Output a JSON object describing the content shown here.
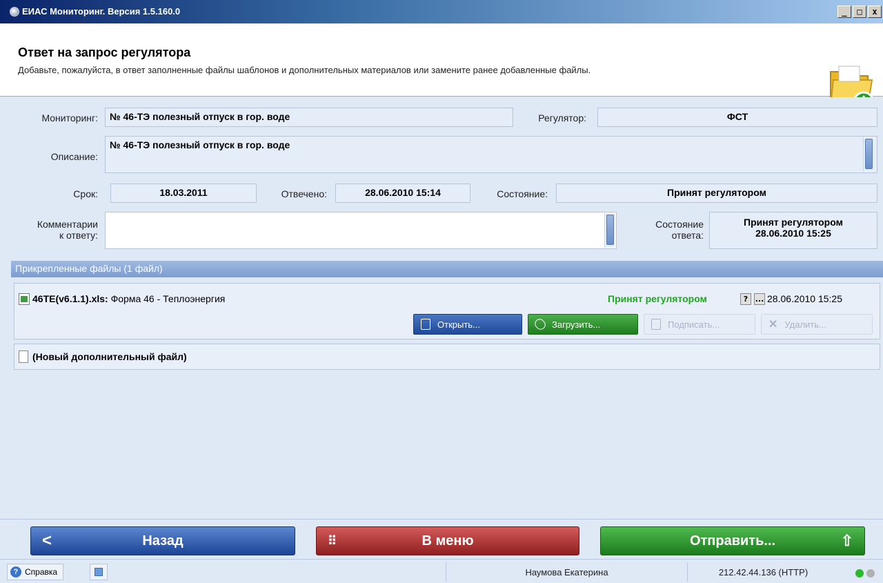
{
  "window": {
    "title": "ЕИАС Мониторинг. Версия 1.5.160.0",
    "minimize": "_",
    "maximize": "□",
    "close": "x"
  },
  "header": {
    "title": "Ответ на запрос регулятора",
    "subtitle": "Добавьте, пожалуйста, в ответ заполненные файлы шаблонов и дополнительных материалов или замените ранее добавленные файлы."
  },
  "form": {
    "monitoring_label": "Мониторинг:",
    "monitoring_value": "№ 46-ТЭ полезный отпуск в гор. воде",
    "regulator_label": "Регулятор:",
    "regulator_value": "ФСТ",
    "description_label": "Описание:",
    "description_value": "№ 46-ТЭ полезный отпуск в гор. воде",
    "deadline_label": "Срок:",
    "deadline_value": "18.03.2011",
    "answered_label": "Отвечено:",
    "answered_value": "28.06.2010 15:14",
    "state_label": "Состояние:",
    "state_value": "Принят регулятором",
    "comments_label_1": "Комментарии",
    "comments_label_2": "к ответу:",
    "comments_value": "",
    "answer_state_label_1": "Состояние",
    "answer_state_label_2": "ответа:",
    "answer_state_value_1": "Принят регулятором",
    "answer_state_value_2": "28.06.2010 15:25"
  },
  "files": {
    "section_title": "Прикрепленные файлы (1 файл)",
    "items": [
      {
        "name": "46TE(v6.1.1).xls:",
        "description": "Форма 46 - Теплоэнергия",
        "status": "Принят регулятором",
        "help_btn": "?",
        "more_btn": "...",
        "date": "28.06.2010 15:25",
        "open_label": "Открыть...",
        "upload_label": "Загрузить...",
        "sign_label": "Подписать...",
        "delete_label": "Удалить..."
      }
    ],
    "new_file_label": "(Новый дополнительный файл)"
  },
  "nav": {
    "back_label": "Назад",
    "back_icon": "<",
    "menu_label": "В меню",
    "menu_icon": "⠿",
    "send_label": "Отправить...",
    "send_icon": "⇧"
  },
  "statusbar": {
    "help_label": "Справка",
    "user": "Наумова Екатерина",
    "server": "212.42.44.136 (HTTP)",
    "status_color_1": "#2db82d",
    "status_color_2": "#b0b0b0"
  }
}
